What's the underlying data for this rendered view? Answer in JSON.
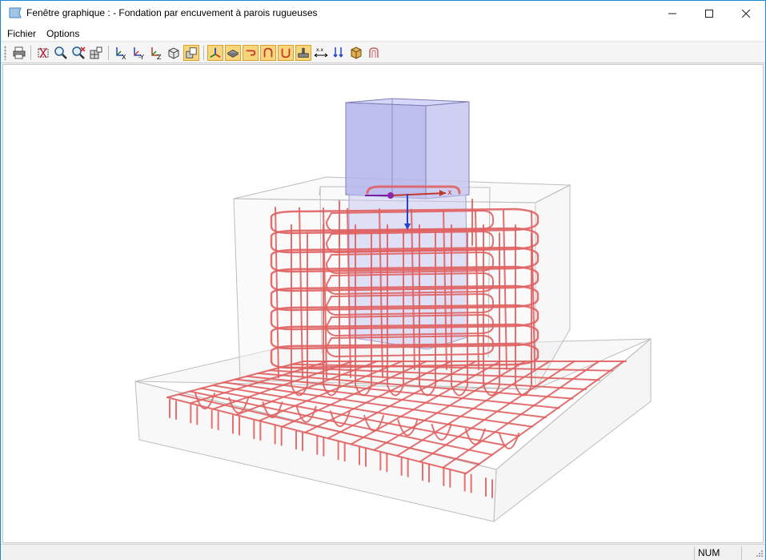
{
  "window": {
    "title": "Fenêtre graphique : - Fondation par encuvement à parois rugueuses"
  },
  "menu": {
    "items": [
      "Fichier",
      "Options"
    ]
  },
  "toolbar": {
    "buttons": [
      {
        "icon": "print-icon",
        "active": false
      },
      {
        "icon": "select-icon",
        "active": false
      },
      {
        "icon": "zoom-icon",
        "active": false
      },
      {
        "icon": "zoom-all-icon",
        "active": false
      },
      {
        "icon": "grid-view-icon",
        "active": false
      },
      {
        "icon": "view-x-icon",
        "active": false
      },
      {
        "icon": "view-y-icon",
        "active": false
      },
      {
        "icon": "view-z-icon",
        "active": false
      },
      {
        "icon": "iso-view-icon",
        "active": false
      },
      {
        "icon": "wireframe-icon",
        "active": true
      },
      {
        "icon": "axes-icon",
        "active": true
      },
      {
        "icon": "slab-icon",
        "active": true
      },
      {
        "icon": "bar-hook-icon",
        "active": true
      },
      {
        "icon": "bar-u-icon",
        "active": true
      },
      {
        "icon": "stirrup-icon",
        "active": true
      },
      {
        "icon": "foundation-icon",
        "active": true
      },
      {
        "icon": "dimension-icon",
        "active": false
      },
      {
        "icon": "loads-icon",
        "active": false
      },
      {
        "icon": "material-icon",
        "active": false
      },
      {
        "icon": "rebar-shape-icon",
        "active": false
      }
    ]
  },
  "viewport": {
    "rebar_color": "#e06060",
    "concrete_color": "#bfbfbf",
    "column_color": "#b4b4ec",
    "axis_colors": {
      "x": "#c0392b",
      "y": "#7b1fa2",
      "z": "#2743c9"
    },
    "axis_labels": {
      "x": "x"
    }
  },
  "status": {
    "num": "NUM"
  }
}
